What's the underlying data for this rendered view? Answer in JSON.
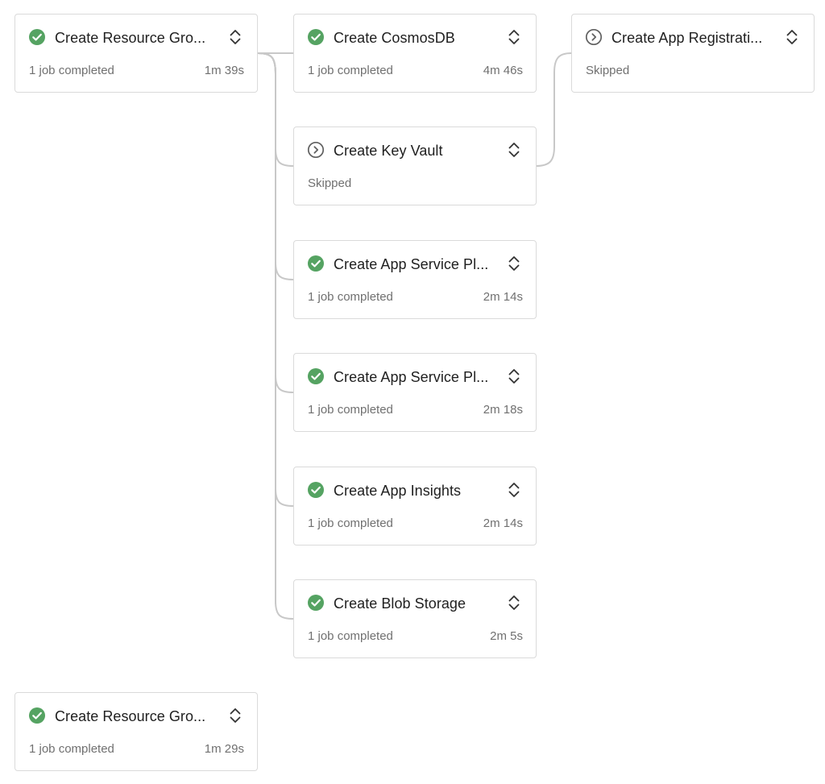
{
  "stages": [
    {
      "id": "rg1",
      "title": "Create Resource Gro...",
      "status": "succeeded",
      "status_icon": "check-circle-icon",
      "summary": "1 job completed",
      "duration": "1m 39s"
    },
    {
      "id": "cosmos",
      "title": "Create CosmosDB",
      "status": "succeeded",
      "status_icon": "check-circle-icon",
      "summary": "1 job completed",
      "duration": "4m 46s"
    },
    {
      "id": "appreg",
      "title": "Create App Registrati...",
      "status": "skipped",
      "status_icon": "skip-circle-icon",
      "summary": "Skipped",
      "duration": ""
    },
    {
      "id": "keyvault",
      "title": "Create Key Vault",
      "status": "skipped",
      "status_icon": "skip-circle-icon",
      "summary": "Skipped",
      "duration": ""
    },
    {
      "id": "asp1",
      "title": "Create App Service Pl...",
      "status": "succeeded",
      "status_icon": "check-circle-icon",
      "summary": "1 job completed",
      "duration": "2m 14s"
    },
    {
      "id": "asp2",
      "title": "Create App Service Pl...",
      "status": "succeeded",
      "status_icon": "check-circle-icon",
      "summary": "1 job completed",
      "duration": "2m 18s"
    },
    {
      "id": "insights",
      "title": "Create App Insights",
      "status": "succeeded",
      "status_icon": "check-circle-icon",
      "summary": "1 job completed",
      "duration": "2m 14s"
    },
    {
      "id": "blob",
      "title": "Create Blob Storage",
      "status": "succeeded",
      "status_icon": "check-circle-icon",
      "summary": "1 job completed",
      "duration": "2m 5s"
    },
    {
      "id": "rg2",
      "title": "Create Resource Gro...",
      "status": "succeeded",
      "status_icon": "check-circle-icon",
      "summary": "1 job completed",
      "duration": "1m 29s"
    }
  ],
  "expand_icon": "chevron-up-down-icon",
  "colors": {
    "success": "#55a362",
    "skipped": "#606060",
    "connector": "#c8c8c8",
    "border": "#dadada"
  }
}
